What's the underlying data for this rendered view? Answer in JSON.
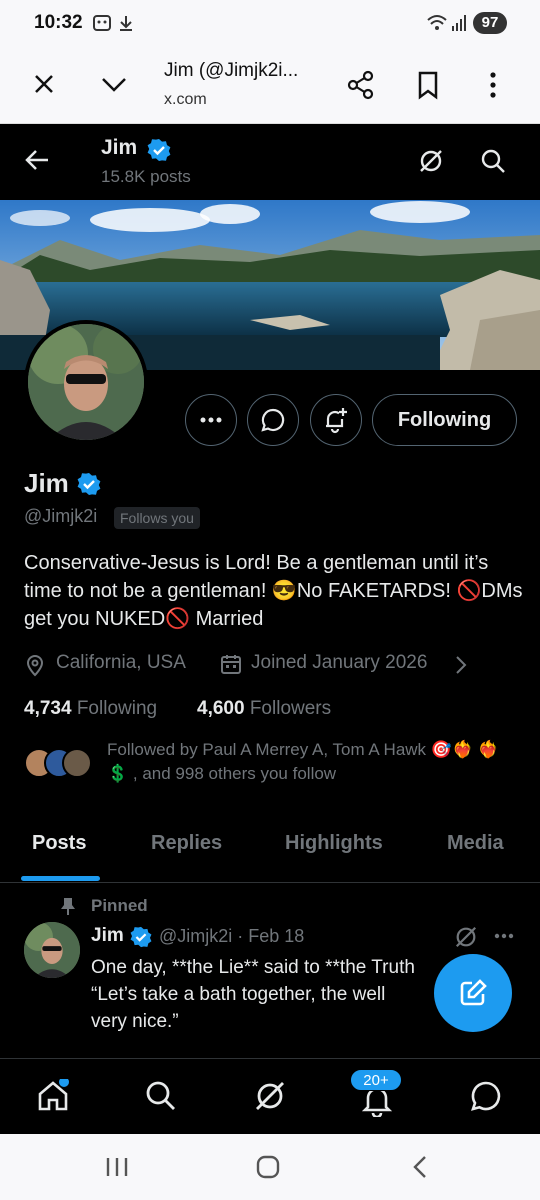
{
  "status_bar": {
    "time": "10:32",
    "battery": "97"
  },
  "browser": {
    "title": "Jim (@Jimjk2i...",
    "url": "x.com"
  },
  "header": {
    "name": "Jim",
    "post_count": "15.8K posts"
  },
  "profile": {
    "name": "Jim",
    "handle": "@Jimjk2i",
    "follows_you": "Follows you",
    "bio": "Conservative-Jesus is Lord! Be a gentleman until it’s time to not be a gentleman! 😎No FAKETARDS! 🚫DMs get you NUKED🚫 Married",
    "location": "California, USA",
    "joined": "Joined January 2026",
    "following_count": "4,734",
    "following_label": "Following",
    "followers_count": "4,600",
    "followers_label": "Followers",
    "followed_by": "Followed by Paul A Merrey A, Tom A Hawk 🎯❤️‍🔥 ❤️‍🔥💲 , and 998 others you follow",
    "following_button": "Following"
  },
  "tabs": [
    {
      "label": "Posts",
      "active": true
    },
    {
      "label": "Replies",
      "active": false
    },
    {
      "label": "Highlights",
      "active": false
    },
    {
      "label": "Media",
      "active": false
    }
  ],
  "post": {
    "pinned_label": "Pinned",
    "author": "Jim",
    "meta": "@Jimjk2i · Feb 18",
    "text": "One day, **the Lie** said to **the Truth\n“Let’s take a bath together, the well\nvery nice.”"
  },
  "bottom_nav": {
    "notification_badge": "20+"
  },
  "colors": {
    "accent": "#1d9bf0",
    "background": "#000000",
    "text": "#e7e9ea",
    "muted": "#71767b"
  }
}
